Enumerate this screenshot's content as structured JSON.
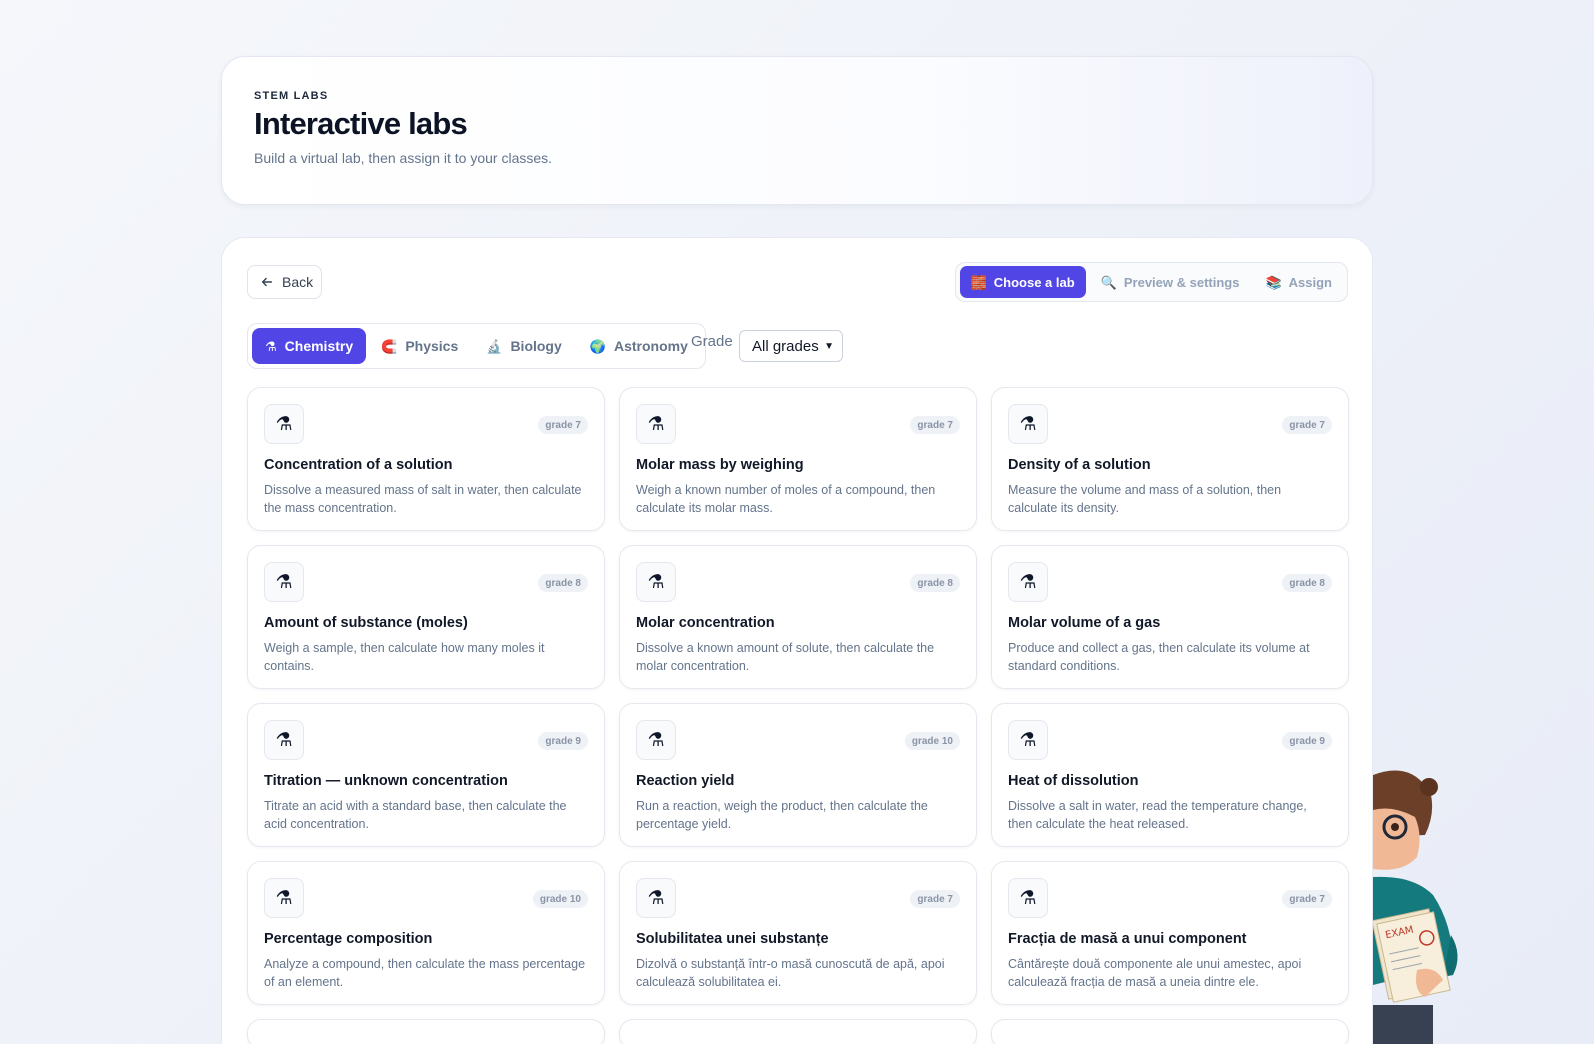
{
  "hero": {
    "eyebrow": "STEM LABS",
    "title": "Interactive labs",
    "subtitle": "Build a virtual lab, then assign it to your classes."
  },
  "toolbar": {
    "back_label": "Back"
  },
  "steps": [
    {
      "label": "Choose a lab",
      "icon": "🧱",
      "active": true
    },
    {
      "label": "Preview & settings",
      "icon": "🔍",
      "active": false
    },
    {
      "label": "Assign",
      "icon": "📚",
      "active": false
    }
  ],
  "subjects": [
    {
      "label": "Chemistry",
      "icon": "⚗",
      "active": true
    },
    {
      "label": "Physics",
      "icon": "🧲",
      "active": false
    },
    {
      "label": "Biology",
      "icon": "🔬",
      "active": false
    },
    {
      "label": "Astronomy",
      "icon": "🌍",
      "active": false
    }
  ],
  "grade_filter": {
    "label": "Grade",
    "selected": "All grades"
  },
  "labs": [
    {
      "title": "Concentration of a solution",
      "grade": "grade 7",
      "description": "Dissolve a measured mass of salt in water, then calculate the mass concentration."
    },
    {
      "title": "Molar mass by weighing",
      "grade": "grade 7",
      "description": "Weigh a known number of moles of a compound, then calculate its molar mass."
    },
    {
      "title": "Density of a solution",
      "grade": "grade 7",
      "description": "Measure the volume and mass of a solution, then calculate its density."
    },
    {
      "title": "Amount of substance (moles)",
      "grade": "grade 8",
      "description": "Weigh a sample, then calculate how many moles it contains."
    },
    {
      "title": "Molar concentration",
      "grade": "grade 8",
      "description": "Dissolve a known amount of solute, then calculate the molar concentration."
    },
    {
      "title": "Molar volume of a gas",
      "grade": "grade 8",
      "description": "Produce and collect a gas, then calculate its volume at standard conditions."
    },
    {
      "title": "Titration — unknown concentration",
      "grade": "grade 9",
      "description": "Titrate an acid with a standard base, then calculate the acid concentration."
    },
    {
      "title": "Reaction yield",
      "grade": "grade 10",
      "description": "Run a reaction, weigh the product, then calculate the percentage yield."
    },
    {
      "title": "Heat of dissolution",
      "grade": "grade 9",
      "description": "Dissolve a salt in water, read the temperature change, then calculate the heat released."
    },
    {
      "title": "Percentage composition",
      "grade": "grade 10",
      "description": "Analyze a compound, then calculate the mass percentage of an element."
    },
    {
      "title": "Solubilitatea unei substanțe",
      "grade": "grade 7",
      "description": "Dizolvă o substanță într-o masă cunoscută de apă, apoi calculează solubilitatea ei."
    },
    {
      "title": "Fracția de masă a unui component",
      "grade": "grade 7",
      "description": "Cântărește două componente ale unui amestec, apoi calculează fracția de masă a uneia dintre ele."
    }
  ],
  "lab_icon": "⚗",
  "mascot_badge": "EXAM",
  "colors": {
    "accent": "#5145e5",
    "muted_text": "#64748b"
  }
}
